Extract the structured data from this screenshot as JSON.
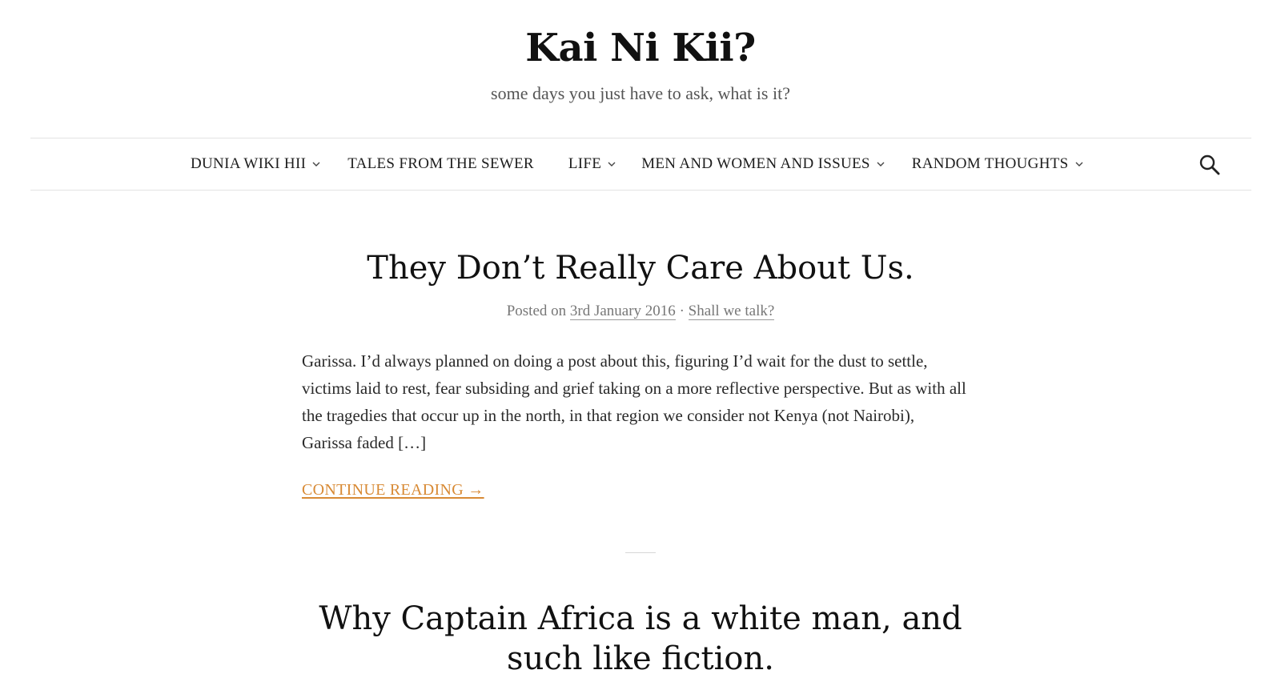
{
  "site": {
    "title": "Kai Ni Kii?",
    "description": "some days you just have to ask, what is it?"
  },
  "nav": {
    "items": [
      {
        "label": "DUNIA WIKI HII",
        "has_dropdown": true
      },
      {
        "label": "TALES FROM THE SEWER",
        "has_dropdown": false
      },
      {
        "label": "LIFE",
        "has_dropdown": true
      },
      {
        "label": "MEN AND WOMEN AND ISSUES",
        "has_dropdown": true
      },
      {
        "label": "RANDOM THOUGHTS",
        "has_dropdown": true
      }
    ],
    "search_icon": "search-icon"
  },
  "posts": [
    {
      "title": "They Don’t Really Care About Us.",
      "meta_prefix": "Posted on",
      "date": "3rd January 2016",
      "separator": "·",
      "category": "Shall we talk?",
      "excerpt": "Garissa. I’d always planned on doing a post about this, figuring I’d wait for the dust to settle, victims laid to rest, fear subsiding and grief taking on a more reflective perspective.  But as with all the tragedies that occur up in the north, in that region we consider not Kenya (not Nairobi), Garissa faded […]",
      "continue_label": "CONTINUE READING →"
    },
    {
      "title": "Why Captain Africa is a white man, and such like fiction."
    }
  ],
  "colors": {
    "accent_link": "#d88a35",
    "text": "#1f1f1f",
    "meta": "#777777",
    "border": "#e3e3e3"
  }
}
